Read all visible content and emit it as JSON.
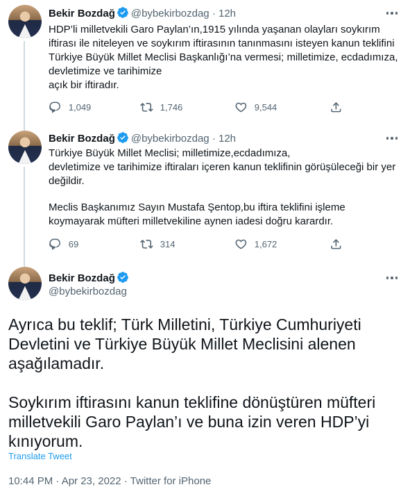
{
  "tweets": [
    {
      "name": "Bekir Bozdağ",
      "handle": "@bybekirbozdag",
      "dot": "·",
      "time": "12h",
      "lines": [
        "HDP’li milletvekili Garo Paylan’ın,1915 yılında yaşanan olayları soykırım",
        "iftirası ile niteleyen ve soykırım iftirasının tanınmasını isteyen kanun teklifini",
        "Türkiye Büyük Millet Meclisi Başkanlığı’na vermesi; milletimize, ecdadımıza,",
        "devletimize ve tarihimize",
        "açık bir iftiradır."
      ],
      "replies": "1,049",
      "retweets": "1,746",
      "likes": "9,544"
    },
    {
      "name": "Bekir Bozdağ",
      "handle": "@bybekirbozdag",
      "dot": "·",
      "time": "12h",
      "lines": [
        "Türkiye Büyük Millet Meclisi; milletimize,ecdadımıza,",
        "devletimize  ve tarihimize iftiraları içeren kanun teklifinin görüşüleceği bir yer",
        "değildir.",
        "",
        "Meclis Başkanımız Sayın Mustafa Şentop,bu iftira teklifini işleme",
        "koymayarak müfteri milletvekiline aynen iadesi doğru karardır."
      ],
      "replies": "69",
      "retweets": "314",
      "likes": "1,672"
    }
  ],
  "main": {
    "name": "Bekir Bozdağ",
    "handle": "@bybekirbozdag",
    "lines": [
      "Ayrıca bu teklif; Türk Milletini, Türkiye Cumhuriyeti",
      "Devletini ve Türkiye Büyük Millet Meclisini alenen",
      "aşağılamadır.",
      "",
      "Soykırım iftirasını kanun teklifine dönüştüren müfteri",
      "milletvekili Garo Paylan’ı ve buna izin veren HDP’yi",
      "kınıyorum."
    ],
    "translate": "Translate Tweet",
    "meta": "10:44 PM · Apr 23, 2022 · Twitter for iPhone"
  },
  "icons": {
    "verified": "verified-badge-icon",
    "reply": "reply-icon",
    "retweet": "retweet-icon",
    "like": "heart-icon",
    "share": "share-icon",
    "more": "more-icon"
  },
  "colors": {
    "accent": "#1d9bf0",
    "text": "#0f1419",
    "secondary": "#536471",
    "divider": "#eff3f4",
    "thread_line": "#cfd9de"
  }
}
